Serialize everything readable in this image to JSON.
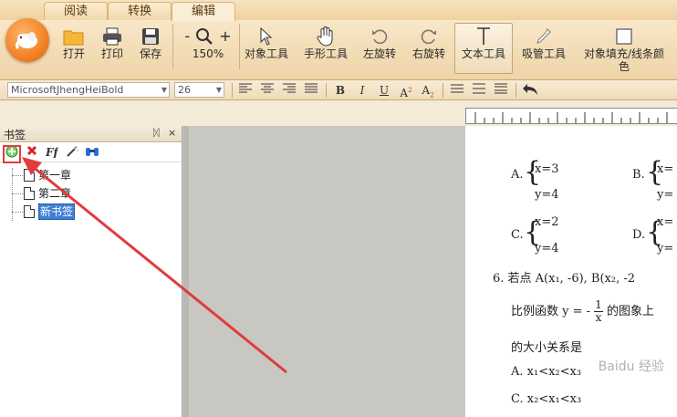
{
  "tabs": [
    "阅读",
    "转换",
    "编辑"
  ],
  "toolbar": {
    "open": "打开",
    "print": "打印",
    "save": "保存",
    "zoom": "150%",
    "zoom_minus": "-",
    "zoom_plus": "+",
    "object_tool": "对象工具",
    "hand_tool": "手形工具",
    "rotate_left": "左旋转",
    "rotate_right": "右旋转",
    "text_tool": "文本工具",
    "eyedropper": "吸管工具",
    "fill_stroke_line1": "对象填充/线条颜",
    "fill_stroke_line2": "色"
  },
  "format": {
    "font": "MicrosoftJhengHeiBold",
    "size": "26",
    "bold": "B",
    "italic": "I",
    "underline": "U",
    "superscript": "A",
    "superscript_mark": "2",
    "subscript": "A",
    "subscript_mark": "2"
  },
  "panel": {
    "title": "书签",
    "pin": "ᛞ",
    "close": "×",
    "items": [
      {
        "label": "第一章"
      },
      {
        "label": "第二章"
      },
      {
        "label": "新书签"
      }
    ]
  },
  "doc": {
    "a_label": "A.",
    "a_x": "x=3",
    "a_y": "y=4",
    "b_label": "B.",
    "b_x": "x=",
    "b_y": "y=",
    "c_label": "C.",
    "c_x": "x=2",
    "c_y": "y=4",
    "d_label": "D.",
    "d_x": "x=",
    "d_y": "y=",
    "q6_line1": "6. 若点 A(x₁, -6), B(x₂, -2",
    "q6_line2_a": "比例函数 y = -",
    "q6_frac_num": "1",
    "q6_frac_den": "x",
    "q6_line2_b": "的图象上",
    "q6_line3": "的大小关系是",
    "q6_optA": "A. x₁<x₂<x₃",
    "q6_optC": "C. x₂<x₁<x₃"
  },
  "watermark": "Baidu 经验",
  "colors": {
    "accent": "#e23b3b",
    "selection": "#3c7fd6"
  }
}
